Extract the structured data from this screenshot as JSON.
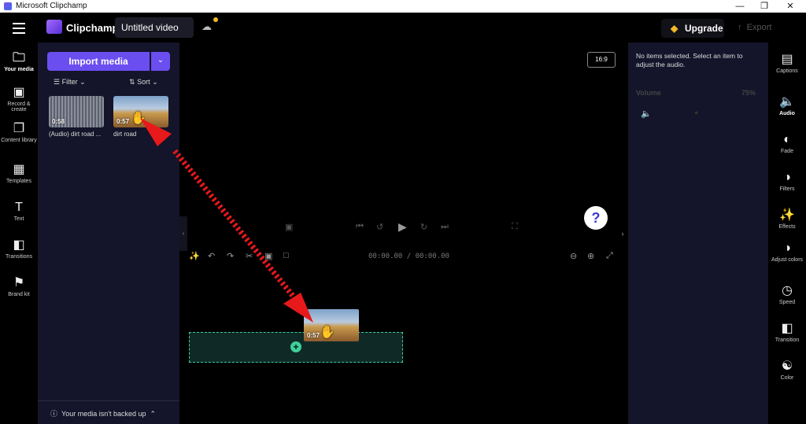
{
  "window": {
    "title": "Microsoft Clipchamp",
    "controls": [
      "minimize",
      "restore",
      "close"
    ]
  },
  "topbar": {
    "brand": "Clipchamp",
    "project_name": "Untitled video",
    "upgrade_label": "Upgrade",
    "export_label": "Export"
  },
  "left_rail": [
    {
      "label": "Your media",
      "icon": "folder-icon",
      "active": true
    },
    {
      "label": "Record & create",
      "icon": "camera-icon"
    },
    {
      "label": "Content library",
      "icon": "library-icon"
    },
    {
      "label": "Templates",
      "icon": "templates-icon"
    },
    {
      "label": "Text",
      "icon": "text-icon"
    },
    {
      "label": "Transitions",
      "icon": "transitions-icon"
    },
    {
      "label": "Brand kit",
      "icon": "brand-kit-icon"
    }
  ],
  "media": {
    "import_label": "Import media",
    "filter_label": "Filter",
    "sort_label": "Sort",
    "items": [
      {
        "duration": "0:58",
        "label": "(Audio) dirt road ..."
      },
      {
        "duration": "0:57",
        "label": "dirt road"
      }
    ],
    "backup_message": "Your media isn't backed up"
  },
  "preview": {
    "aspect_ratio": "16:9",
    "help": "?",
    "timecode": "00:00.00 / 00:00.00"
  },
  "timeline": {
    "drag_clip_duration": "0:57"
  },
  "right_panel": {
    "no_selection": "No items selected. Select an item to adjust the audio.",
    "volume_label": "Volume",
    "volume_value": "75%"
  },
  "right_rail": [
    {
      "label": "Captions",
      "icon": "captions-icon"
    },
    {
      "label": "Audio",
      "icon": "speaker-icon",
      "active": true
    },
    {
      "label": "Fade",
      "icon": "fade-icon"
    },
    {
      "label": "Filters",
      "icon": "filters-icon"
    },
    {
      "label": "Effects",
      "icon": "effects-icon"
    },
    {
      "label": "Adjust colors",
      "icon": "adjust-colors-icon"
    },
    {
      "label": "Speed",
      "icon": "speed-icon"
    },
    {
      "label": "Transition",
      "icon": "transition-icon"
    },
    {
      "label": "Color",
      "icon": "color-icon"
    }
  ],
  "colors": {
    "accent": "#6b4ef0",
    "drop_zone": "#3fcf9a",
    "annotation_arrow": "#e8191a"
  }
}
